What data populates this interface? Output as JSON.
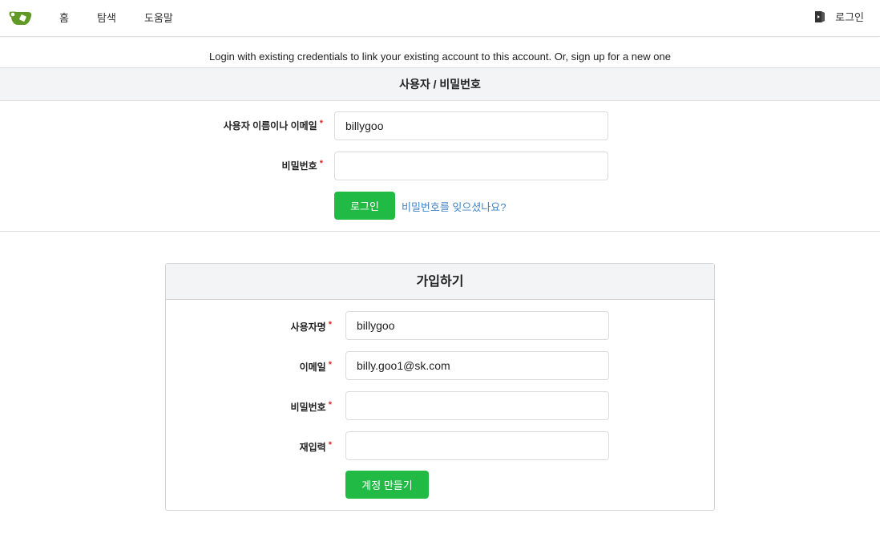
{
  "nav": {
    "home": "홈",
    "explore": "탐색",
    "help": "도움말",
    "signin": "로그인"
  },
  "notice": "Login with existing credentials to link your existing account to this account. Or, sign up for a new one",
  "credentials": {
    "header": "사용자 / 비밀번호",
    "username_label": "사용자 이름이나 이메일",
    "username_value": "billygoo",
    "password_label": "비밀번호",
    "password_value": "",
    "required_mark": "*",
    "login_button": "로그인",
    "forgot_link": "비밀번호를 잊으셨나요?"
  },
  "signup": {
    "header": "가입하기",
    "username_label": "사용자명",
    "username_value": "billygoo",
    "email_label": "이메일",
    "email_value": "billy.goo1@sk.com",
    "password_label": "비밀번호",
    "password_value": "",
    "retype_label": "재입력",
    "retype_value": "",
    "required_mark": "*",
    "create_button": "계정 만들기"
  },
  "colors": {
    "primary_green": "#21ba45",
    "logo_green": "#609926",
    "link_blue": "#4183c4",
    "required_red": "#db2828"
  }
}
